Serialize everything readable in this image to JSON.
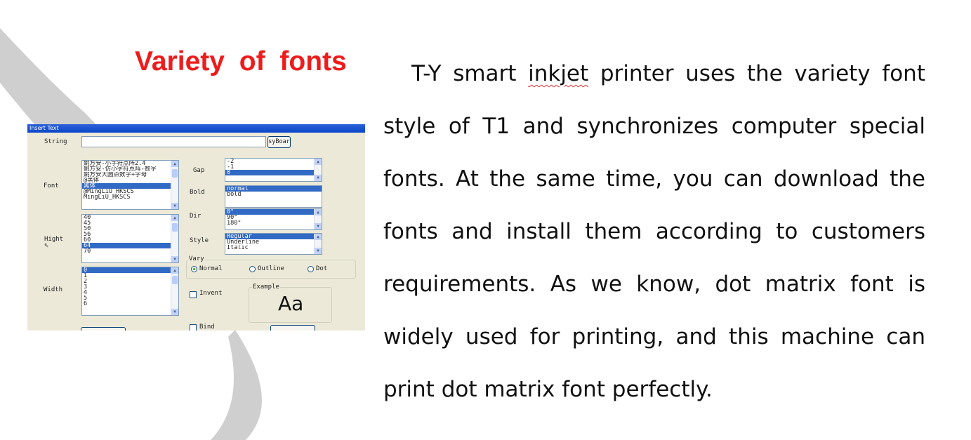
{
  "slide": {
    "title": "Variety of fonts",
    "paragraph_lead": "T-Y smart ",
    "paragraph_misspelled": "inkjet",
    "paragraph_rest": " printer uses the variety font style of T1 and synchronizes computer special fonts. At the same time, you can download the fonts and install them according to customers requirements. As we know, dot matrix font is widely used for printing, and this machine can",
    "paragraph_last_line": "print dot matrix font perfectly.",
    "title_color": "#ee1c1c",
    "accent_gray": "#c7c7c7"
  },
  "dialog": {
    "title": "Insert Text",
    "string_label": "String",
    "string_value": "",
    "keyboard_button": "syBoar",
    "font_label": "Font",
    "font_list": [
      {
        "text": "姚方安-小字符点阵2.4",
        "selected": false
      },
      {
        "text": "姚方安-仿小字符点阵-数字",
        "selected": false
      },
      {
        "text": "姚方安大圆点数字+字母",
        "selected": false
      },
      {
        "text": "@黑体",
        "selected": false
      },
      {
        "text": "黑体",
        "selected": true
      },
      {
        "text": "@MingLiU_HKSCS",
        "selected": false
      },
      {
        "text": "MingLiU_HKSCS",
        "selected": false
      }
    ],
    "hight_label": "Hight",
    "hight_list": [
      {
        "text": "40",
        "selected": false
      },
      {
        "text": "45",
        "selected": false
      },
      {
        "text": "50",
        "selected": false
      },
      {
        "text": "56",
        "selected": false
      },
      {
        "text": "60",
        "selected": false
      },
      {
        "text": "64",
        "selected": true
      },
      {
        "text": "70",
        "selected": false
      }
    ],
    "width_label": "Width",
    "width_list": [
      {
        "text": "0",
        "selected": true
      },
      {
        "text": "1",
        "selected": false
      },
      {
        "text": "2",
        "selected": false
      },
      {
        "text": "3",
        "selected": false
      },
      {
        "text": "4",
        "selected": false
      },
      {
        "text": "5",
        "selected": false
      },
      {
        "text": "6",
        "selected": false
      }
    ],
    "gap_label": "Gap",
    "gap_list": [
      {
        "text": "-2",
        "selected": false
      },
      {
        "text": "-1",
        "selected": false
      },
      {
        "text": "0",
        "selected": true
      }
    ],
    "bold_label": "Bold",
    "bold_list": [
      {
        "text": "normal",
        "selected": true
      },
      {
        "text": "bold",
        "selected": false
      }
    ],
    "dir_label": "Dir",
    "dir_list": [
      {
        "text": "0°",
        "selected": true
      },
      {
        "text": "90°",
        "selected": false
      },
      {
        "text": "180°",
        "selected": false
      }
    ],
    "style_label": "Style",
    "style_list": [
      {
        "text": "Regular",
        "selected": true
      },
      {
        "text": "Underline",
        "selected": false
      },
      {
        "text": "Italic",
        "selected": false
      }
    ],
    "vary_label": "Vary",
    "vary_normal": "Normal",
    "vary_outline": "Outline",
    "vary_dot": "Dot",
    "vary_selected": "Normal",
    "invent_label": "Invent",
    "bind_label": "Bind",
    "example_label": "Example",
    "example_text": "Aa",
    "titlebar_color": "#0a46c8",
    "selection_color": "#316ac5"
  }
}
